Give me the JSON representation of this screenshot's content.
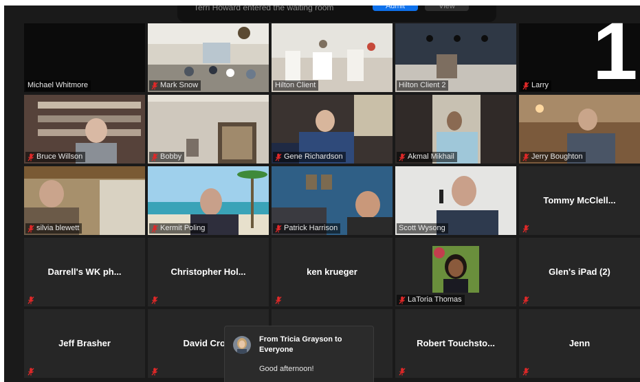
{
  "notification": {
    "text": "Terri Howard entered the waiting room",
    "admit_label": "Admit",
    "view_label": "View"
  },
  "slide_number": "1",
  "participants": [
    {
      "name": "Michael Whitmore",
      "muted": false,
      "video": true,
      "scene": "dark"
    },
    {
      "name": "Mark Snow",
      "muted": true,
      "video": true,
      "scene": "banquet-hall",
      "active_speaker": true
    },
    {
      "name": "Hilton Client",
      "muted": false,
      "video": true,
      "scene": "dining-room"
    },
    {
      "name": "Hilton Client 2",
      "muted": false,
      "video": true,
      "scene": "bar"
    },
    {
      "name": "Larry",
      "muted": true,
      "video": true,
      "scene": "dark"
    },
    {
      "name": "Bruce Willson",
      "muted": true,
      "video": true,
      "scene": "bookshelf"
    },
    {
      "name": "Bobby",
      "muted": true,
      "video": true,
      "scene": "wall-art"
    },
    {
      "name": "Gene Richardson",
      "muted": true,
      "video": true,
      "scene": "office"
    },
    {
      "name": "Akmal Mikhail",
      "muted": true,
      "video": true,
      "scene": "clinic"
    },
    {
      "name": "Jerry Boughton",
      "muted": true,
      "video": true,
      "scene": "den"
    },
    {
      "name": "silvia blewett",
      "muted": true,
      "video": true,
      "scene": "curtains"
    },
    {
      "name": "Kermit Poling",
      "muted": true,
      "video": true,
      "scene": "beach"
    },
    {
      "name": "Patrick Harrison",
      "muted": true,
      "video": true,
      "scene": "blue-room"
    },
    {
      "name": "Scott Wysong",
      "muted": false,
      "video": true,
      "scene": "bright"
    },
    {
      "name": "Tommy McClell...",
      "muted": true,
      "video": false
    },
    {
      "name": "Darrell's WK ph...",
      "muted": true,
      "video": false
    },
    {
      "name": "Christopher Hol...",
      "muted": true,
      "video": false
    },
    {
      "name": "ken krueger",
      "muted": true,
      "video": false
    },
    {
      "name": "LaToria Thomas",
      "muted": true,
      "video": false,
      "photo": true
    },
    {
      "name": "Glen's iPad (2)",
      "muted": true,
      "video": false
    },
    {
      "name": "Jeff Brasher",
      "muted": true,
      "video": false
    },
    {
      "name": "David Crom",
      "muted": true,
      "video": false
    },
    {
      "name": "",
      "muted": false,
      "video": false
    },
    {
      "name": "Robert Touchsto...",
      "muted": true,
      "video": false
    },
    {
      "name": "Jenn",
      "muted": true,
      "video": false
    }
  ],
  "chat_popup": {
    "from": "From Tricia Grayson to Everyone",
    "message": "Good afternoon!"
  },
  "colors": {
    "background": "#1a1a1a",
    "tile": "#262626",
    "active_border": "#c9e265",
    "mute_icon": "#e02828",
    "admit_button": "#0e71eb"
  }
}
